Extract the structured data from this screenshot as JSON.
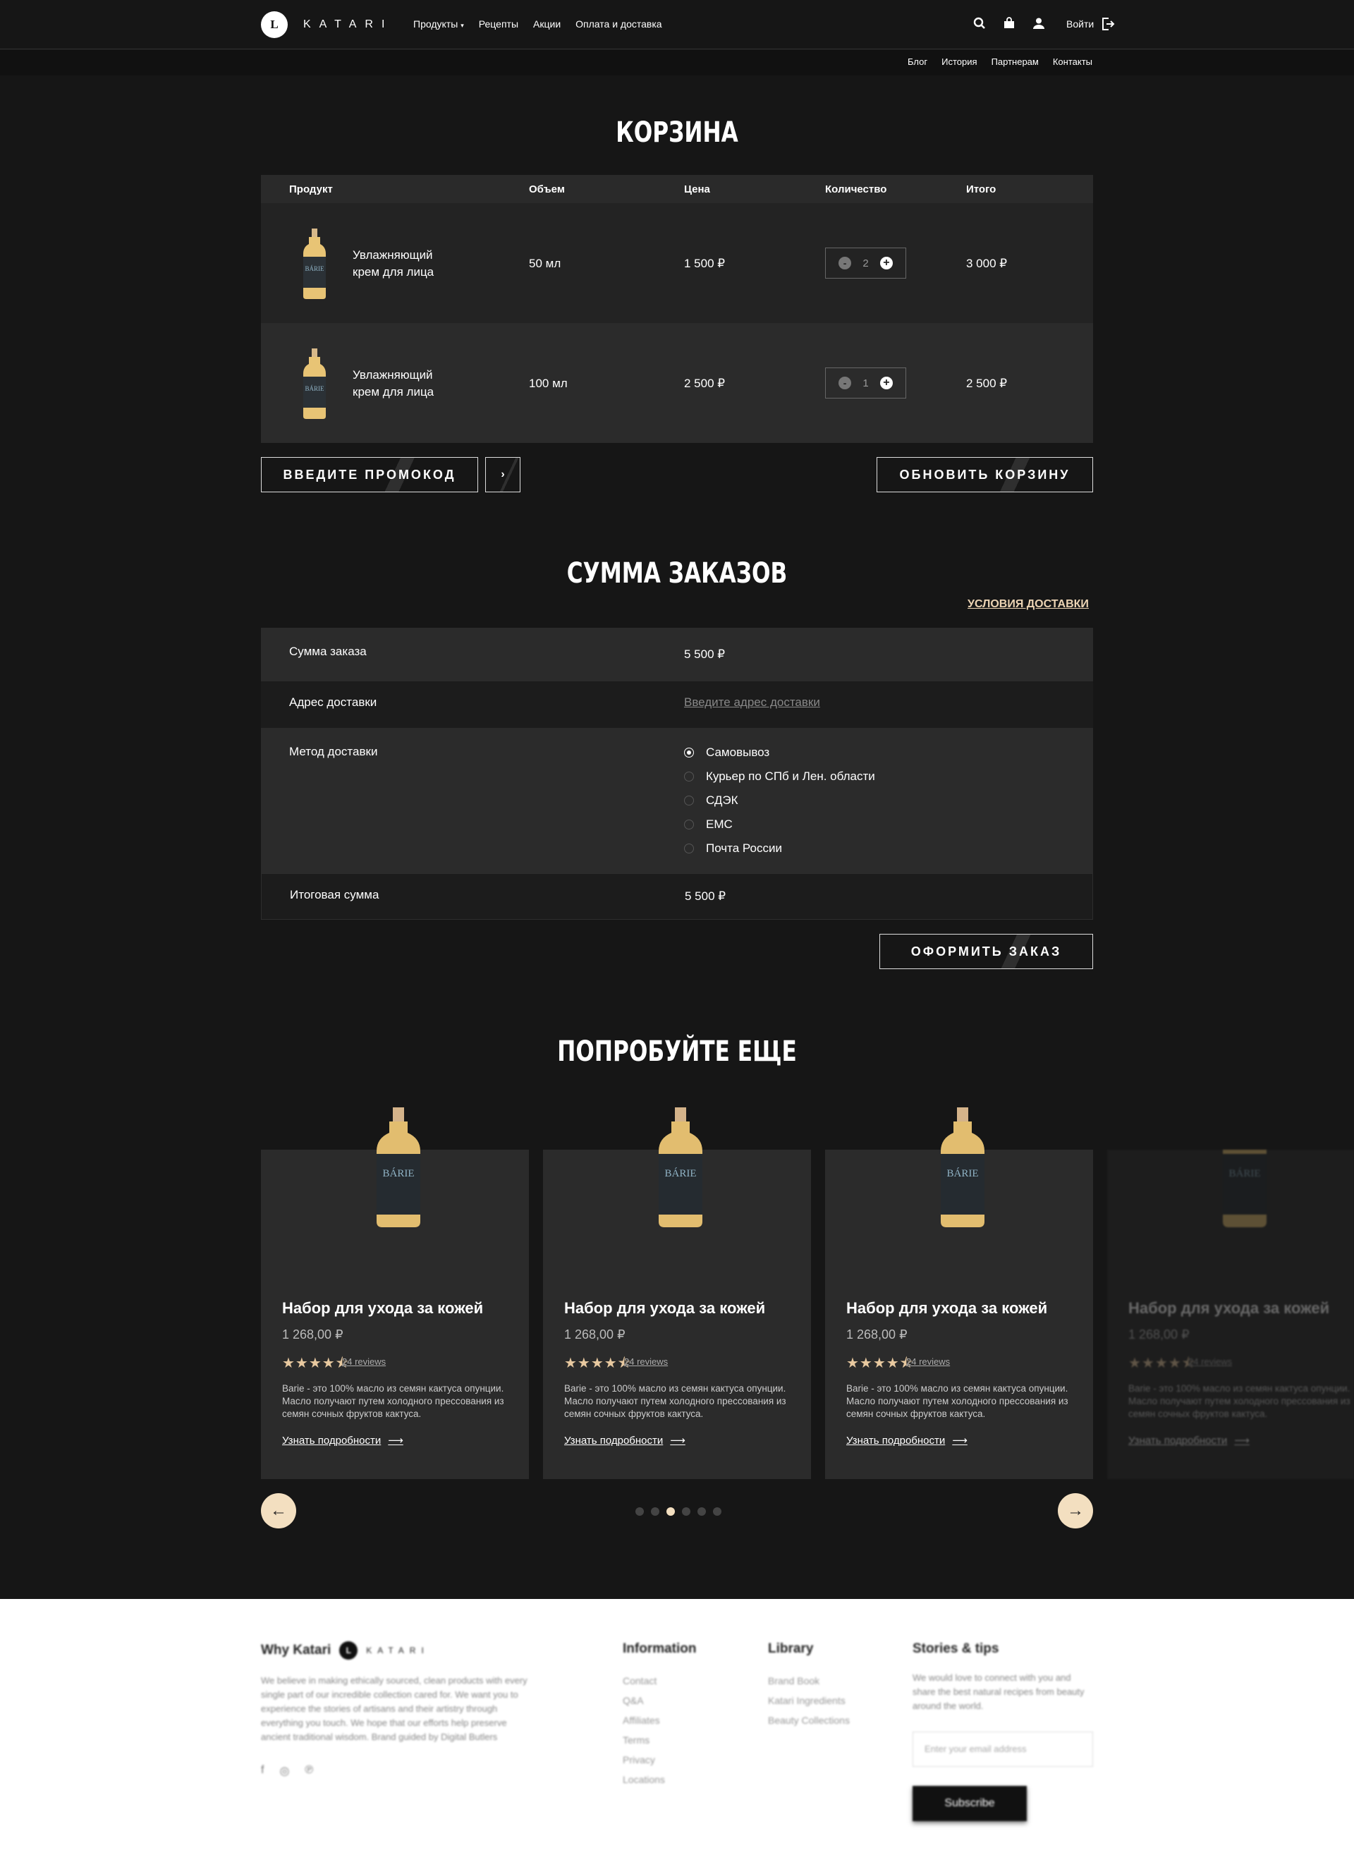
{
  "header": {
    "logo_mark": "L",
    "logo_text": "KATARI",
    "nav": [
      "Продукты",
      "Рецепты",
      "Акции",
      "Оплата и доставка"
    ],
    "login": "Войти",
    "subnav": [
      "Блог",
      "История",
      "Партнерам",
      "Контакты"
    ]
  },
  "cart": {
    "title": "КОРЗИНА",
    "columns": [
      "Продукт",
      "Объем",
      "Цена",
      "Количество",
      "Итого"
    ],
    "rows": [
      {
        "name": "Увлажняющий крем для лица",
        "volume": "50 мл",
        "price": "1 500 ₽",
        "qty": "2",
        "total": "3 000 ₽"
      },
      {
        "name": "Увлажняющий крем для лица",
        "volume": "100 мл",
        "price": "2 500 ₽",
        "qty": "1",
        "total": "2 500 ₽"
      }
    ],
    "promo_button": "ВВЕДИТЕ ПРОМОКОД",
    "update_button": "ОБНОВИТЬ КОРЗИНУ"
  },
  "summary": {
    "title": "СУММА ЗАКАЗОВ",
    "delivery_terms": "УСЛОВИЯ ДОСТАВКИ",
    "order_sum_label": "Сумма заказа",
    "order_sum_value": "5 500 ₽",
    "address_label": "Адрес доставки",
    "address_placeholder": "Введите адрес доставки",
    "method_label": "Метод доставки",
    "methods": [
      "Самовывоз",
      "Курьер по СПб и Лен. области",
      "СДЭК",
      "EMC",
      "Почта России"
    ],
    "selected_method": "Самовывоз",
    "total_label": "Итоговая сумма",
    "total_value": "5 500 ₽",
    "checkout_button": "ОФОРМИТЬ ЗАКАЗ"
  },
  "recommend": {
    "title": "ПОПРОБУЙТЕ ЕЩЕ",
    "products": [
      {
        "title": "Набор для ухода за кожей",
        "price": "1 268,00 ₽",
        "stars": "★★★★⯪",
        "reviews": "24 reviews",
        "desc": "Barie - это 100% масло из семян кактуса опунции. Масло получают путем холодного прессования из семян сочных фруктов кактуса.",
        "more": "Узнать подробности"
      },
      {
        "title": "Набор для ухода за кожей",
        "price": "1 268,00 ₽",
        "stars": "★★★★⯪",
        "reviews": "24 reviews",
        "desc": "Barie - это 100% масло из семян кактуса опунции. Масло получают путем холодного прессования из семян сочных фруктов кактуса.",
        "more": "Узнать подробности"
      },
      {
        "title": "Набор для ухода за кожей",
        "price": "1 268,00 ₽",
        "stars": "★★★★⯪",
        "reviews": "24 reviews",
        "desc": "Barie - это 100% масло из семян кактуса опунции. Масло получают путем холодного прессования из семян сочных фруктов кактуса.",
        "more": "Узнать подробности"
      },
      {
        "title": "Набор для ухода за кожей",
        "price": "1 268,00 ₽",
        "stars": "★★★★⯪",
        "reviews": "24 reviews",
        "desc": "Barie - это 100% масло из семян кактуса опунции. Масло получают путем холодного прессования из семян сочных фруктов кактуса.",
        "more": "Узнать подробности"
      }
    ],
    "active_dot": 3,
    "dot_count": 6
  },
  "footer": {
    "why_title": "Why Katari",
    "why_text": "We believe in making ethically sourced, clean products with every single part of our incredible collection cared for. We want you to experience the stories of artisans and their artistry through everything you touch. We hope that our efforts help preserve ancient traditional wisdom. Brand guided by Digital Butlers",
    "info_title": "Information",
    "info_links": [
      "Contact",
      "Q&A",
      "Affiliates",
      "Terms",
      "Privacy",
      "Locations"
    ],
    "library_title": "Library",
    "library_links": [
      "Brand Book",
      "Katari Ingredients",
      "Beauty Collections"
    ],
    "stories_title": "Stories & tips",
    "stories_text": "We would love to connect with you and share the best natural recipes from beauty around the world.",
    "email_placeholder": "Enter your email address",
    "subscribe": "Subscribe"
  },
  "colors": {
    "accent": "#f3dfc0",
    "link": "#ecd4b4",
    "background": "#161616"
  }
}
